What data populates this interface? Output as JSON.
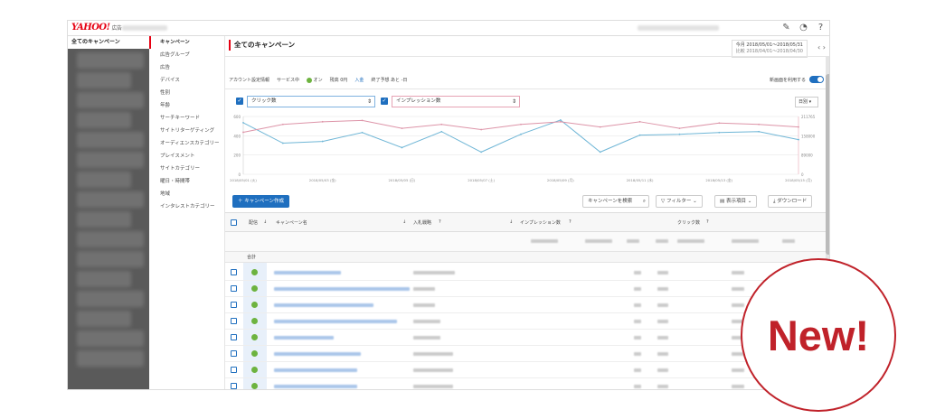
{
  "app": {
    "logo": "YAHOO!",
    "logo_sub": "広告"
  },
  "account_sidebar": {
    "header": "全てのキャンペーン"
  },
  "nav": {
    "items": [
      "キャンペーン",
      "広告グループ",
      "広告",
      "デバイス",
      "性別",
      "年齢",
      "サーチキーワード",
      "サイトリターゲティング",
      "オーディエンスカテゴリー",
      "プレイスメント",
      "サイトカテゴリー",
      "曜日・時間帯",
      "地域",
      "インタレストカテゴリー"
    ]
  },
  "page": {
    "title": "全てのキャンペーン"
  },
  "date": {
    "main": "今月 2018/05/01～2018/05/31",
    "compare": "比較 2018/04/01～2018/04/30"
  },
  "info": {
    "account_link": "アカウント設定情報",
    "service_label": "サービス中",
    "status": "オン",
    "balance": "残高 0円",
    "deposit": "入金",
    "budget": "終了予想 あと -日",
    "toggle_label": "新画面を利用する"
  },
  "chart_controls": {
    "metric1": "クリック数",
    "metric2": "インプレッション数",
    "granularity": "日別"
  },
  "chart_data": {
    "type": "line",
    "x": [
      "2018/05/01 (火)",
      "2018/05/03 (木)",
      "2018/05/05 (土)",
      "2018/05/07 (月)",
      "2018/05/09 (水)",
      "2018/05/11 (金)",
      "2018/05/13 (日)",
      "2018/05/15 (火)"
    ],
    "x_tick_labels": [
      "2018/05/01 (火)",
      "2018/05/03 (金)",
      "2018/05/05 (日)",
      "2018/05/07 (土)",
      "2018/05/09 (月)",
      "2018/05/11 (水)",
      "2018/05/13 (金)",
      "2018/05/15 (月)"
    ],
    "y_left_ticks": [
      "600",
      "400",
      "200",
      "0"
    ],
    "y_right_ticks": [
      "211765",
      "158000",
      "89000",
      "0"
    ],
    "series": [
      {
        "name": "クリック数",
        "color": "#6fb6d6",
        "values": [
          580,
          350,
          370,
          470,
          300,
          480,
          250,
          450,
          610,
          250,
          440,
          450,
          470,
          480,
          390
        ]
      },
      {
        "name": "インプレッション数",
        "color": "#dd94a8",
        "values": [
          160000,
          190000,
          200000,
          205000,
          175000,
          190000,
          170000,
          190000,
          200000,
          180000,
          200000,
          175000,
          195000,
          190000,
          180000
        ]
      }
    ],
    "ylim": [
      0,
      650
    ]
  },
  "toolbar": {
    "create": "＋ キャンペーン作成",
    "search": "キャンペーンを検索",
    "filter": "フィルター",
    "columns": "表示項目",
    "download": "ダウンロード"
  },
  "table": {
    "headers": [
      "配信",
      "キャンペーン名",
      "入札戦略",
      "インプレッション数",
      "クリック数"
    ],
    "total_label": "合計"
  },
  "badge": {
    "text": "New!"
  },
  "colors": {
    "accent": "#1f6fbf",
    "brand": "#e60012",
    "badge": "#c0222a",
    "on": "#6db33f"
  }
}
